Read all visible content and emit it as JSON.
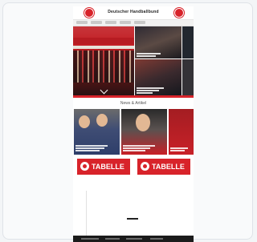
{
  "site": {
    "title": "Deutscher Handballbund"
  },
  "section": {
    "title": "News & Artikel"
  },
  "promos": [
    {
      "label": "TABELLE"
    },
    {
      "label": "TABELLE"
    }
  ],
  "colors": {
    "brand_red": "#d8232a",
    "background": "#f3f5f7",
    "footer": "#1b1b1b"
  },
  "icons": [
    "logo-icon",
    "chevron-down-icon",
    "table-icon"
  ]
}
